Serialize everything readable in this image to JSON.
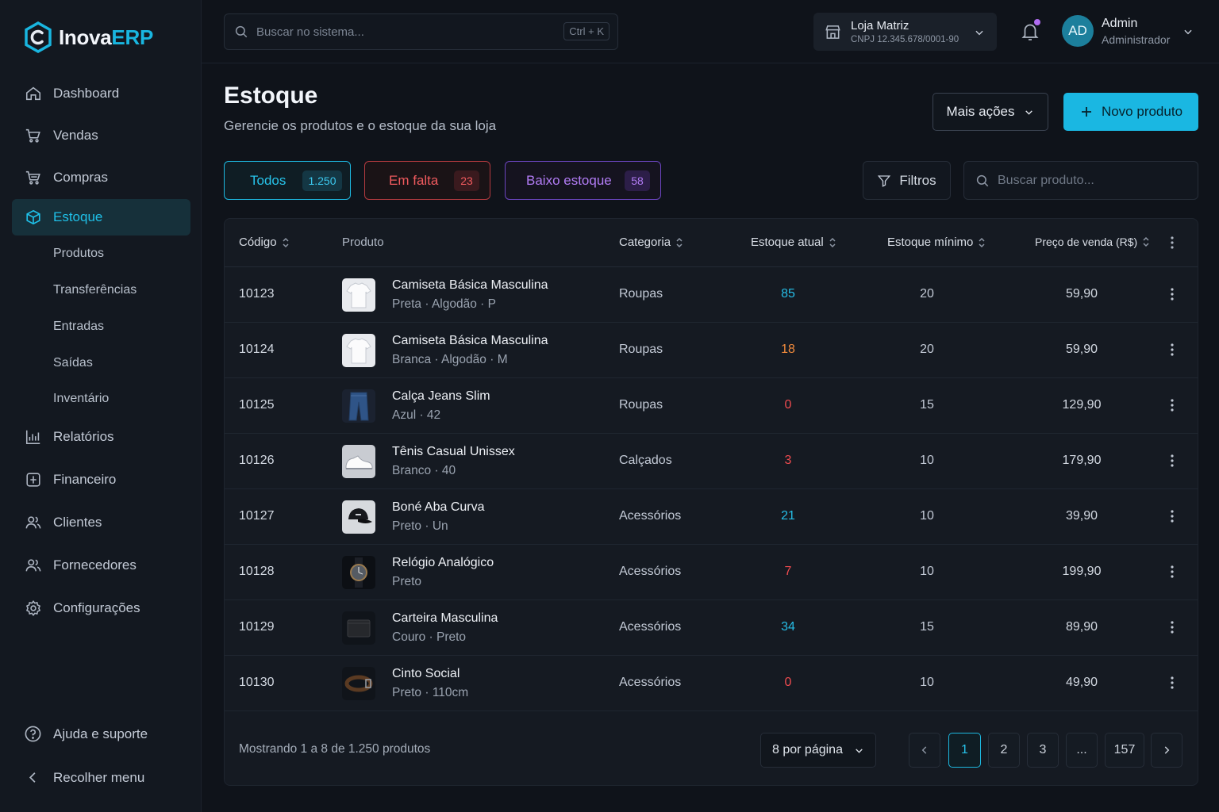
{
  "app": {
    "logo_a": "Inova",
    "logo_b": "ERP"
  },
  "sidebar": {
    "items": [
      {
        "label": "Dashboard",
        "icon": "home-icon"
      },
      {
        "label": "Vendas",
        "icon": "cart-icon"
      },
      {
        "label": "Compras",
        "icon": "shopping-cart-icon"
      },
      {
        "label": "Estoque",
        "icon": "box-icon",
        "active": true
      },
      {
        "label": "Relatórios",
        "icon": "bar-chart-icon"
      },
      {
        "label": "Financeiro",
        "icon": "finance-icon"
      },
      {
        "label": "Clientes",
        "icon": "users-icon"
      },
      {
        "label": "Fornecedores",
        "icon": "supplier-icon"
      },
      {
        "label": "Configurações",
        "icon": "settings-icon"
      }
    ],
    "sub_items": [
      "Produtos",
      "Transferências",
      "Entradas",
      "Saídas",
      "Inventário"
    ],
    "help": "Ajuda e suporte",
    "collapse": "Recolher menu"
  },
  "topbar": {
    "search_placeholder": "Buscar no sistema...",
    "shortcut": "Ctrl + K",
    "store_name": "Loja Matriz",
    "store_cnpj": "CNPJ 12.345.678/0001-90",
    "avatar_initials": "AD",
    "user_name": "Admin",
    "user_role": "Administrador"
  },
  "page": {
    "title": "Estoque",
    "subtitle": "Gerencie os produtos e o estoque da sua loja",
    "more_actions": "Mais ações",
    "new_product": "Novo produto"
  },
  "filters": {
    "all_label": "Todos",
    "all_count": "1.250",
    "out_label": "Em falta",
    "out_count": "23",
    "low_label": "Baixo estoque",
    "low_count": "58",
    "filters_button": "Filtros",
    "search_placeholder": "Buscar produto..."
  },
  "table": {
    "headers": {
      "code": "Código",
      "product": "Produto",
      "category": "Categoria",
      "stock": "Estoque atual",
      "min_stock": "Estoque mínimo",
      "price": "Preço de venda (R$)"
    },
    "rows": [
      {
        "code": "10123",
        "name": "Camiseta Básica Masculina",
        "variant": "Preta · Algodão · P",
        "category": "Roupas",
        "stock": "85",
        "status": "ok",
        "min": "20",
        "price": "59,90",
        "thumb": "tshirt"
      },
      {
        "code": "10124",
        "name": "Camiseta Básica Masculina",
        "variant": "Branca · Algodão · M",
        "category": "Roupas",
        "stock": "18",
        "status": "low",
        "min": "20",
        "price": "59,90",
        "thumb": "tshirt"
      },
      {
        "code": "10125",
        "name": "Calça Jeans Slim",
        "variant": "Azul · 42",
        "category": "Roupas",
        "stock": "0",
        "status": "out",
        "min": "15",
        "price": "129,90",
        "thumb": "jeans"
      },
      {
        "code": "10126",
        "name": "Tênis Casual Unissex",
        "variant": "Branco · 40",
        "category": "Calçados",
        "stock": "3",
        "status": "out",
        "min": "10",
        "price": "179,90",
        "thumb": "sneaker"
      },
      {
        "code": "10127",
        "name": "Boné Aba Curva",
        "variant": "Preto · Un",
        "category": "Acessórios",
        "stock": "21",
        "status": "ok",
        "min": "10",
        "price": "39,90",
        "thumb": "cap"
      },
      {
        "code": "10128",
        "name": "Relógio Analógico",
        "variant": "Preto",
        "category": "Acessórios",
        "stock": "7",
        "status": "out",
        "min": "10",
        "price": "199,90",
        "thumb": "watch"
      },
      {
        "code": "10129",
        "name": "Carteira Masculina",
        "variant": "Couro · Preto",
        "category": "Acessórios",
        "stock": "34",
        "status": "ok",
        "min": "15",
        "price": "89,90",
        "thumb": "wallet"
      },
      {
        "code": "10130",
        "name": "Cinto Social",
        "variant": "Preto · 110cm",
        "category": "Acessórios",
        "stock": "0",
        "status": "out",
        "min": "10",
        "price": "49,90",
        "thumb": "belt"
      }
    ],
    "footer": "Mostrando 1 a 8 de 1.250 produtos",
    "per_page": "8 por página",
    "pages": [
      "1",
      "2",
      "3",
      "...",
      "157"
    ]
  },
  "colors": {
    "accent": "#1ab7e2",
    "ok": "#26bde6",
    "low": "#f08a3c",
    "out": "#ef4b4f"
  }
}
